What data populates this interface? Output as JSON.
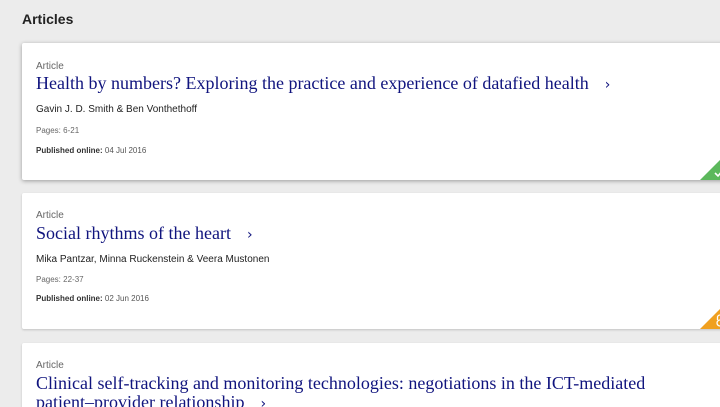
{
  "section": {
    "title": "Articles"
  },
  "articles": [
    {
      "type": "Article",
      "title": "Health by numbers? Exploring the practice and experience of datafied health",
      "authors": "Gavin J. D. Smith & Ben Vonthethoff",
      "pages": "Pages: 6-21",
      "published_label": "Published online:",
      "published_date": "04 Jul 2016",
      "access_color": "#5cb85c",
      "access_icon": "check-icon"
    },
    {
      "type": "Article",
      "title": "Social rhythms of the heart",
      "authors": "Mika Pantzar, Minna Ruckenstein & Veera Mustonen",
      "pages": "Pages: 22-37",
      "published_label": "Published online:",
      "published_date": "02 Jun 2016",
      "access_color": "#f0a020",
      "access_icon": "open-access-icon"
    },
    {
      "type": "Article",
      "title": "Clinical self-tracking and monitoring technologies: negotiations in the ICT-mediated patient–provider relationship"
    }
  ],
  "chevron": "›"
}
